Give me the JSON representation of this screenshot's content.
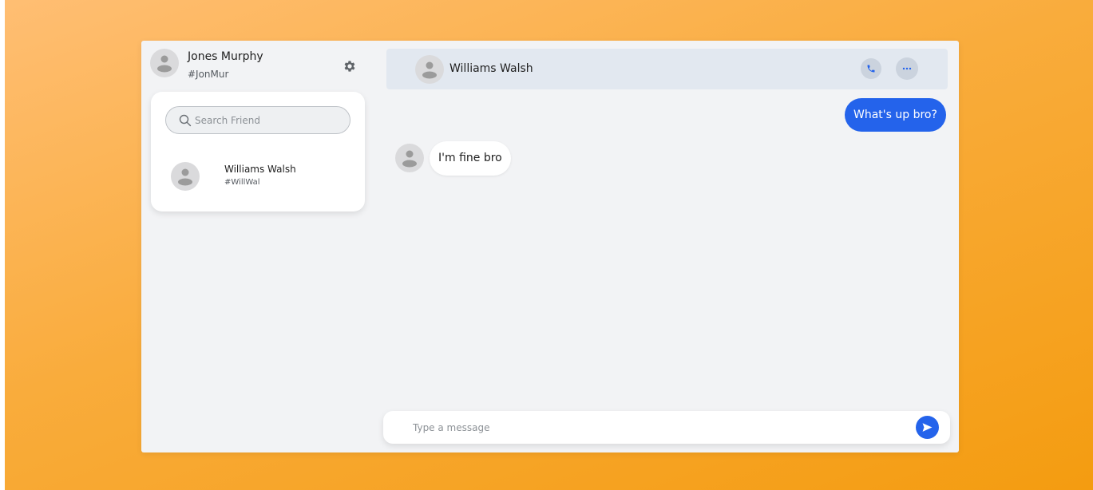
{
  "colors": {
    "accent": "#2463eb",
    "background_gradient_start": "#ffbe73",
    "background_gradient_end": "#f49c10",
    "panel": "#f2f3f5",
    "chat_header": "#e2e8f0"
  },
  "profile": {
    "name": "Jones Murphy",
    "handle": "#JonMur",
    "avatar_icon": "user-avatar-icon",
    "settings_icon": "gear-icon"
  },
  "search": {
    "placeholder": "Search Friend",
    "value": "",
    "icon": "search-icon"
  },
  "friends": [
    {
      "name": "Williams Walsh",
      "handle": "#WillWal"
    }
  ],
  "chat": {
    "title": "Williams Walsh",
    "call_icon": "phone-icon",
    "more_icon": "more-horizontal-icon",
    "messages": [
      {
        "direction": "outgoing",
        "text": "What's up bro?"
      },
      {
        "direction": "incoming",
        "text": "I'm fine bro"
      }
    ]
  },
  "composer": {
    "placeholder": "Type a message",
    "value": "",
    "send_icon": "send-icon"
  }
}
